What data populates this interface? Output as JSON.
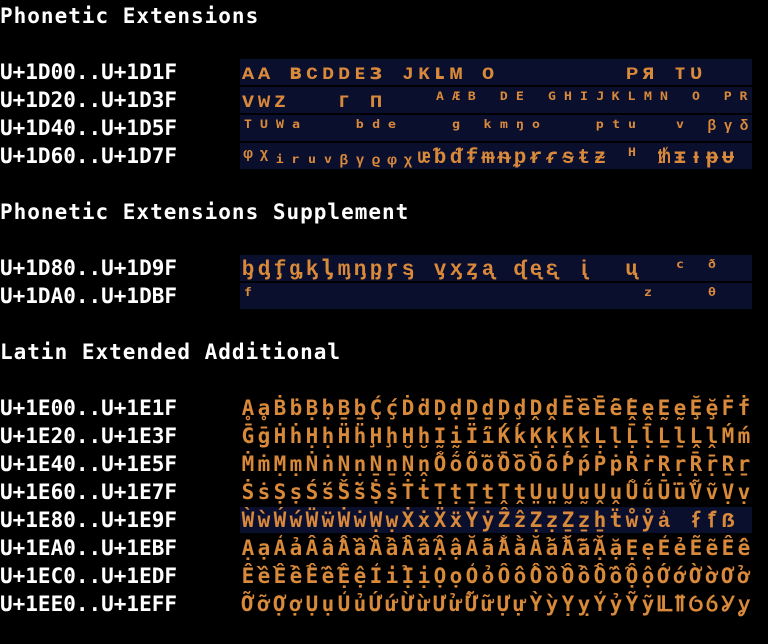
{
  "sections": [
    {
      "title": "Phonetic Extensions",
      "rows": [
        {
          "range": "U+1D00..U+1D1F",
          "glyphs": "ᴀᴀ ʙᴄᴅᴅᴇɜ ᴊᴋʟᴍ ᴏ        ᴘя ᴛᴜ   "
        },
        {
          "range": "U+1D20..U+1D3F",
          "glyphs": "ᴠᴡᴢ   ᴦ ᴨ   ᴬᴭᴮ ᴰᴱ ᴳᴴᴵᴶᴷᴸᴹᴺ ᴼ ᴾᴿ"
        },
        {
          "range": "U+1D40..U+1D5F",
          "glyphs": "ᵀᵁᵂᵃ   ᵇᵈᵉ   ᵍ ᵏᵐᵑᵒ   ᵖᵗᵘ  ᵛ ᵝᵞᵟ"
        },
        {
          "range": "U+1D60..U+1D7F",
          "glyphs": "ᵠᵡᵢᵣᵤᵥᵦᵧᵨᵩᵪᵫᵬᵭᵮᵯᵰᵱᵲᵳᵴᵵᵶ ᵸ ᵺᵻᵼᵽᵾ "
        }
      ]
    },
    {
      "title": "Phonetic Extensions Supplement",
      "rows": [
        {
          "range": "U+1D80..U+1D9F",
          "glyphs": "ᶀᶁᶂᶃᶄᶅᶆᶇᶈᶉᶊ ᶌᶍᶎᶏ ᶑᶒᶓ ᶖ  ᶙ  ᶜ ᶞ "
        },
        {
          "range": "U+1DA0..U+1DBF",
          "glyphs": "ᶠ                        ᶻ   ᶿ"
        }
      ]
    },
    {
      "title": "Latin Extended Additional",
      "rows": [
        {
          "range": "U+1E00..U+1E1F",
          "glyphs": "ḀḁḂḃḄḅḆḇḈḉḊḋḌḍḎḏḐḑḒḓḔḕḖḗḘḙḚḛḜḝḞḟ"
        },
        {
          "range": "U+1E20..U+1E3F",
          "glyphs": "ḠḡḢḣḤḥḦḧḨḩḪḫḬḭḮḯḰḱḲḳḴḵḶḷḸḹḺḻḼḽḾḿ"
        },
        {
          "range": "U+1E40..U+1E5F",
          "glyphs": "ṀṁṂṃṄṅṆṇṈṉṊṋṌṍṎṏṐṑṒṓṔṕṖṗṘṙṚṛṜṝṞṟ"
        },
        {
          "range": "U+1E60..U+1E7F",
          "glyphs": "ṠṡṢṣṤṥṦṧṨṩṪṫṬṭṮṯṰṱṲṳṴṵṶṷṸṹṺṻṼṽṾṿ"
        },
        {
          "range": "U+1E80..U+1E9F",
          "glyphs": "ẀẁẂẃẄẅẆẇẈẉẊẋẌẍẎẏẐẑẒẓẔẕẖẗẘẙẚ ẜẝẞ "
        },
        {
          "range": "U+1EA0..U+1EBF",
          "glyphs": "ẠạẢảẤấẦầẨẩẪẫẬậẮắẰằẲẳẴẵẶặẸẹẺẻẼẽẾế"
        },
        {
          "range": "U+1EC0..U+1EDF",
          "glyphs": "ỀềỂểỄễỆệỈỉỊịỌọỎỏỐốỒồỔổỖỗỘộỚớỜờỞở"
        },
        {
          "range": "U+1EE0..U+1EFF",
          "glyphs": "ỠỡỢợỤụỦủỨứỪừỬửỮữỰựỲỳỴỵỶỷỸỹỺỻỼỽỾỿ"
        }
      ]
    }
  ]
}
